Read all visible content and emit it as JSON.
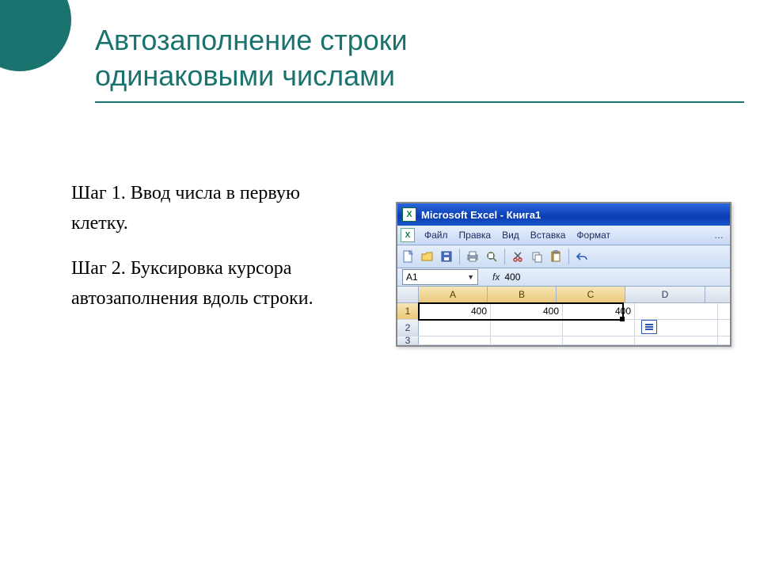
{
  "title": "Автозаполнение строки\nодинаковыми числами",
  "steps": {
    "step1": "Шаг 1. Ввод числа в первую клетку.",
    "step2": "Шаг 2. Буксировка курсора автозаполнения вдоль строки."
  },
  "excel": {
    "titlebar": "Microsoft Excel - Книга1",
    "menu": {
      "file": "Файл",
      "edit": "Правка",
      "view": "Вид",
      "insert": "Вставка",
      "format": "Формат"
    },
    "namebox": "A1",
    "fx_label": "fx",
    "formula_value": "400",
    "columns": [
      "A",
      "B",
      "C",
      "D"
    ],
    "rows": [
      "1",
      "2",
      "3"
    ],
    "cells": {
      "A1": "400",
      "B1": "400",
      "C1": "400"
    }
  }
}
